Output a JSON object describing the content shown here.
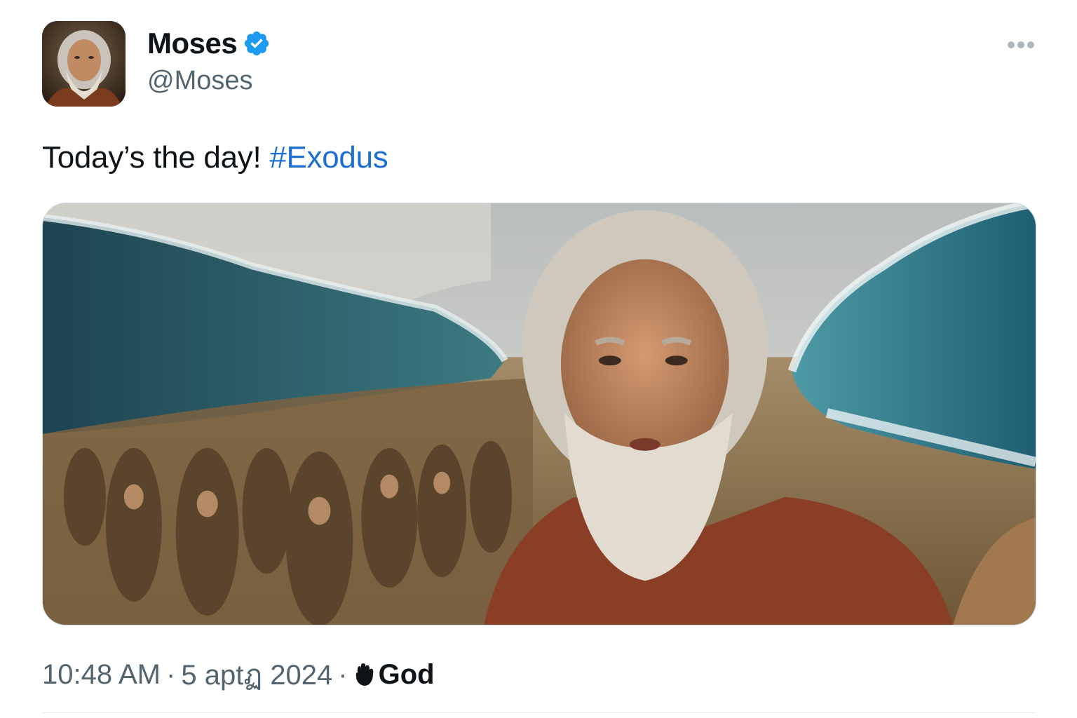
{
  "author": {
    "display_name": "Moses",
    "handle": "@Moses",
    "verified": true,
    "avatar_icon": "bearded-man-avatar"
  },
  "tweet": {
    "text": "Today’s the day! ",
    "hashtag": "#Exodus",
    "media_description_icon": "parting-sea-selfie-photo"
  },
  "footer": {
    "time": "10:48 AM",
    "separator": "·",
    "date": "5 aptฏ 2024",
    "source": "God",
    "source_icon": "hand-icon"
  },
  "colors": {
    "accent": "#1d9bf0",
    "hashtag": "#1d6fd1",
    "secondary_text": "#536471",
    "primary_text": "#0f1419"
  }
}
